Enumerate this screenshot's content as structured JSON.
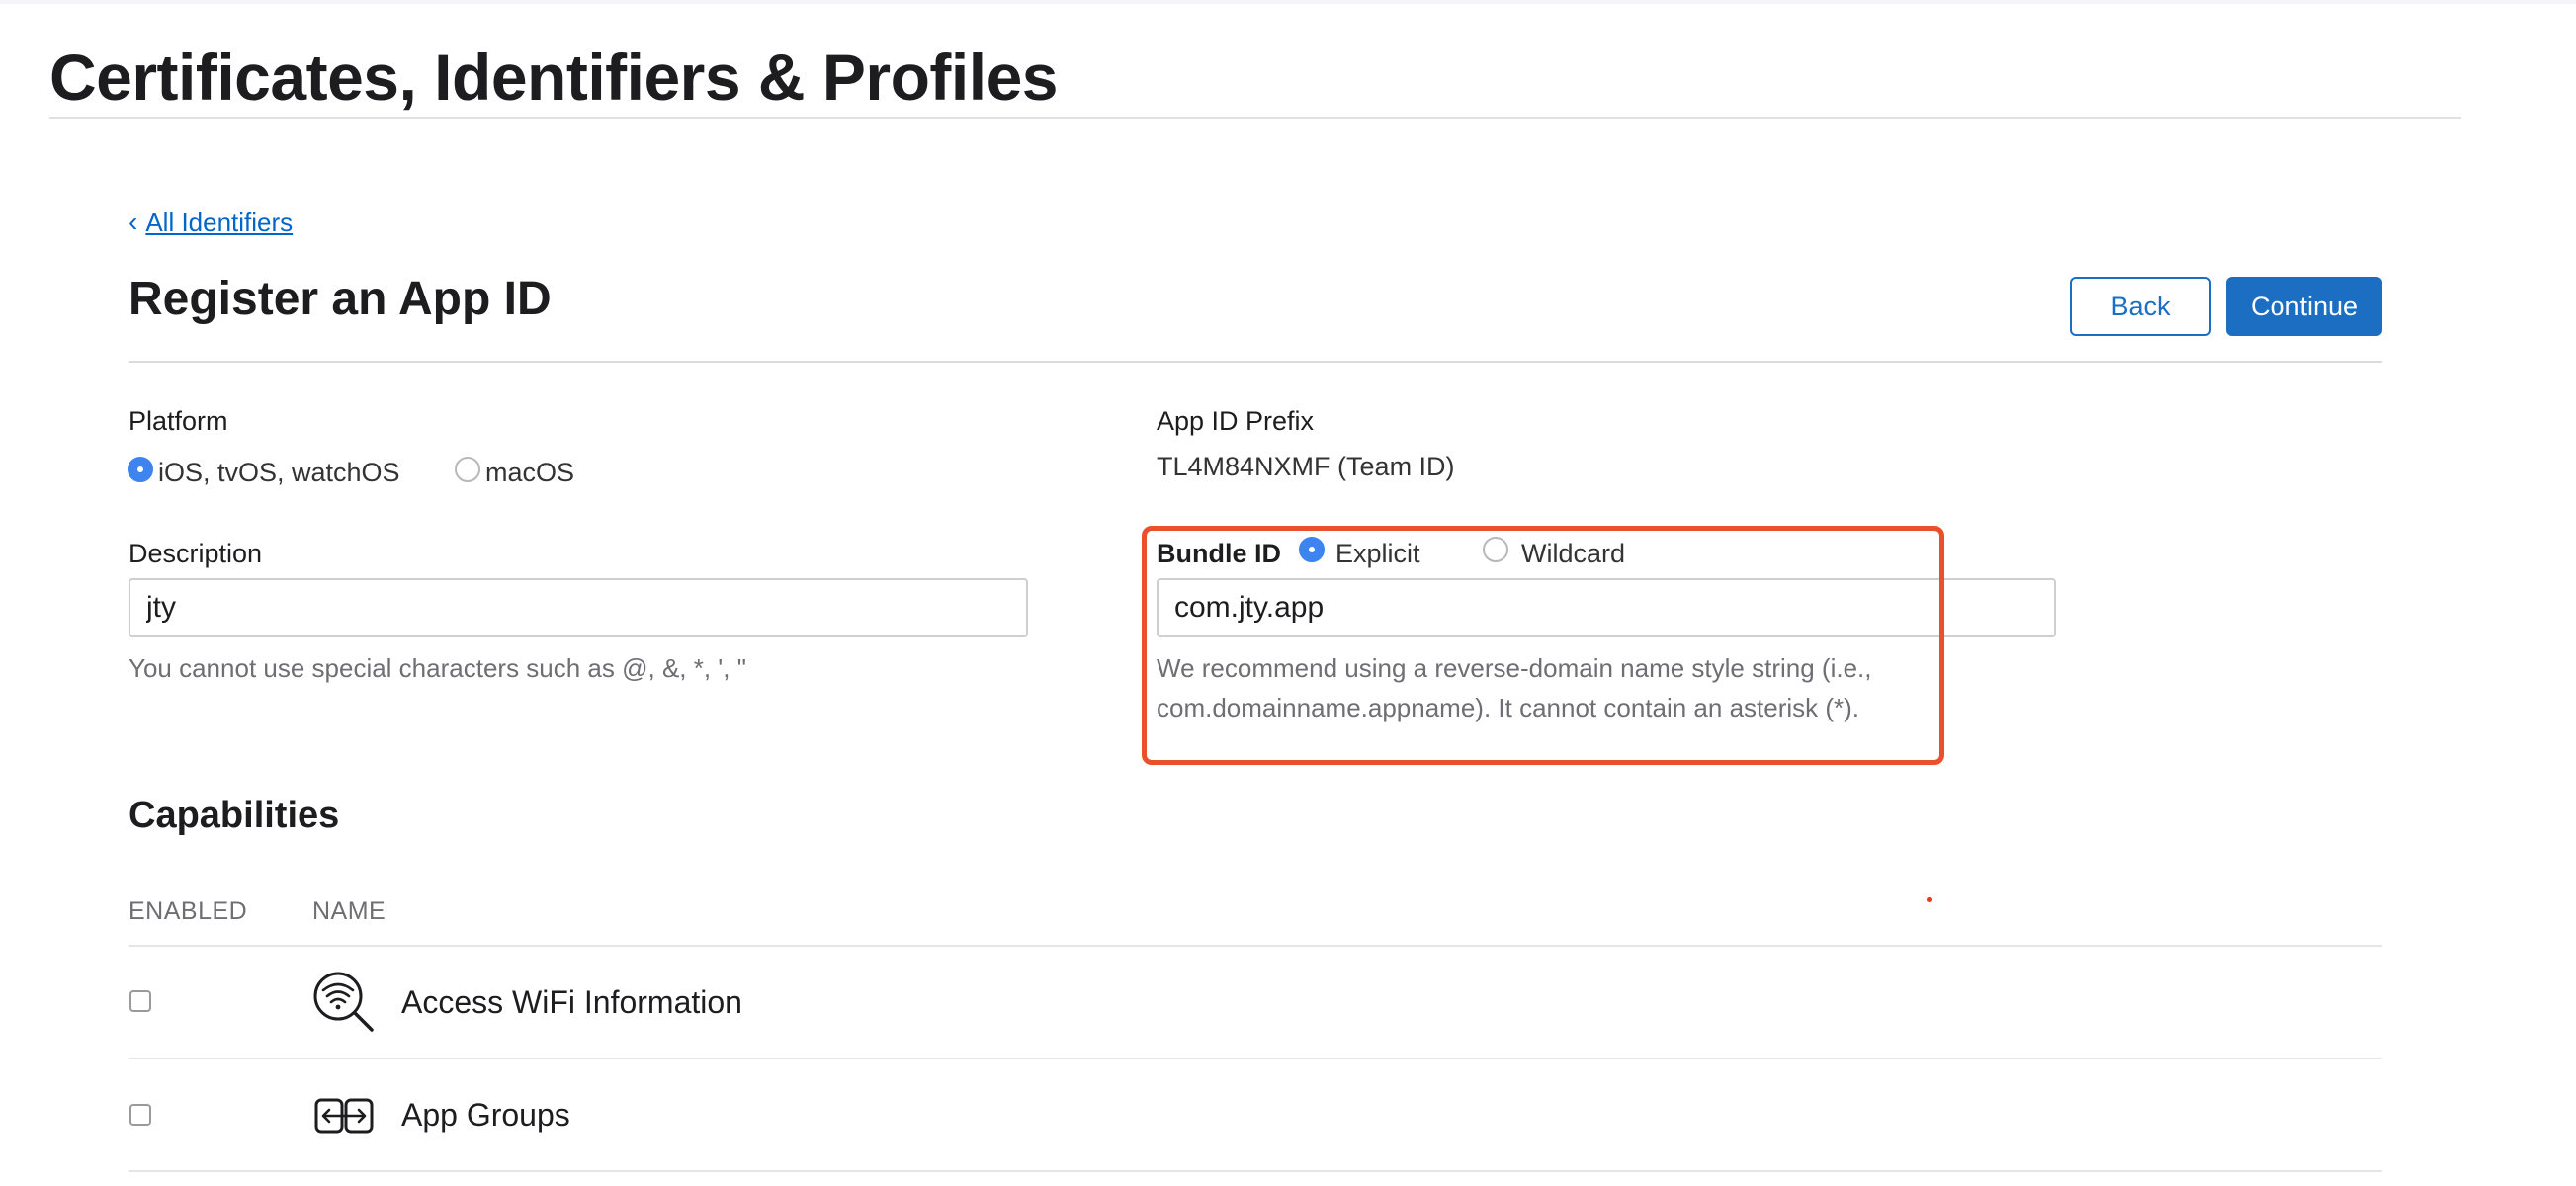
{
  "header": {
    "title": "Certificates, Identifiers & Profiles"
  },
  "nav": {
    "back_link": "All Identifiers",
    "back_chevron": "‹"
  },
  "form": {
    "title": "Register an App ID",
    "buttons": {
      "back": "Back",
      "continue": "Continue"
    },
    "platform": {
      "label": "Platform",
      "options": [
        {
          "label": "iOS, tvOS, watchOS",
          "selected": true
        },
        {
          "label": "macOS",
          "selected": false
        }
      ]
    },
    "app_id_prefix": {
      "label": "App ID Prefix",
      "value": "TL4M84NXMF (Team ID)"
    },
    "description": {
      "label": "Description",
      "value": "jty",
      "help": "You cannot use special characters such as @, &, *, ', \""
    },
    "bundle_id": {
      "label": "Bundle ID",
      "options": [
        {
          "label": "Explicit",
          "selected": true
        },
        {
          "label": "Wildcard",
          "selected": false
        }
      ],
      "value": "com.jty.app",
      "help_line1": "We recommend using a reverse-domain name style string (i.e.,",
      "help_line2": "com.domainname.appname). It cannot contain an asterisk (*)."
    }
  },
  "capabilities": {
    "title": "Capabilities",
    "columns": {
      "enabled": "ENABLED",
      "name": "NAME"
    },
    "rows": [
      {
        "name": "Access WiFi Information",
        "icon": "wifi-search-icon",
        "enabled": false
      },
      {
        "name": "App Groups",
        "icon": "app-groups-icon",
        "enabled": false
      }
    ]
  },
  "colors": {
    "accent": "#1b6ec2",
    "link": "#0066cc",
    "highlight": "#e8512b",
    "radio": "#3d84f0"
  }
}
